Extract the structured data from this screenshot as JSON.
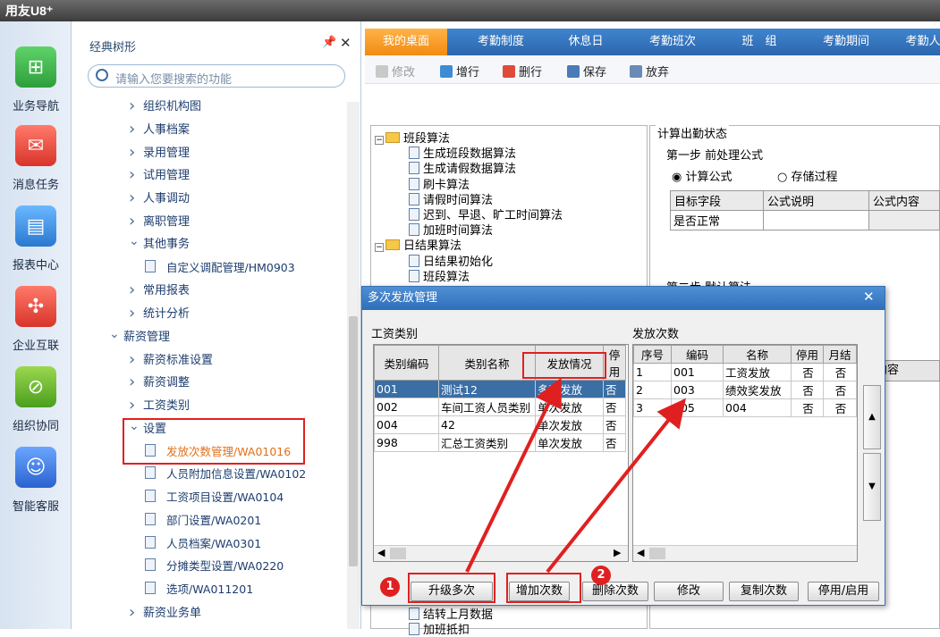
{
  "app": {
    "logo": "用友U8⁺"
  },
  "leftnav": [
    {
      "label": "业务导航",
      "icon": "business-navigation-icon",
      "color": "#3db34a"
    },
    {
      "label": "消息任务",
      "icon": "message-task-icon",
      "color": "#e8504a"
    },
    {
      "label": "报表中心",
      "icon": "report-center-icon",
      "color": "#2f8ee0"
    },
    {
      "label": "企业互联",
      "icon": "enterprise-connect-icon",
      "color": "#e8504a"
    },
    {
      "label": "组织协同",
      "icon": "org-collaboration-icon",
      "color": "#6bb82e"
    },
    {
      "label": "智能客服",
      "icon": "smart-service-icon",
      "color": "#3a7bd8"
    }
  ],
  "treepanel": {
    "title": "经典树形",
    "search_placeholder": "请输入您要搜索的功能",
    "nodes": [
      {
        "label": "组织机构图",
        "kind": "folder"
      },
      {
        "label": "人事档案",
        "kind": "folder"
      },
      {
        "label": "录用管理",
        "kind": "folder"
      },
      {
        "label": "试用管理",
        "kind": "folder"
      },
      {
        "label": "人事调动",
        "kind": "folder"
      },
      {
        "label": "离职管理",
        "kind": "folder"
      },
      {
        "label": "其他事务",
        "kind": "open"
      },
      {
        "label": "自定义调配管理/HM0903",
        "kind": "leaf"
      },
      {
        "label": "常用报表",
        "kind": "folder"
      },
      {
        "label": "统计分析",
        "kind": "folder"
      },
      {
        "label": "薪资管理",
        "kind": "open-root"
      },
      {
        "label": "薪资标准设置",
        "kind": "folder"
      },
      {
        "label": "薪资调整",
        "kind": "folder"
      },
      {
        "label": "工资类别",
        "kind": "folder"
      },
      {
        "label": "设置",
        "kind": "open"
      },
      {
        "label": "发放次数管理/WA01016",
        "kind": "leaf-active"
      },
      {
        "label": "人员附加信息设置/WA0102",
        "kind": "leaf"
      },
      {
        "label": "工资项目设置/WA0104",
        "kind": "leaf"
      },
      {
        "label": "部门设置/WA0201",
        "kind": "leaf"
      },
      {
        "label": "人员档案/WA0301",
        "kind": "leaf"
      },
      {
        "label": "分摊类型设置/WA0220",
        "kind": "leaf"
      },
      {
        "label": "选项/WA011201",
        "kind": "leaf"
      },
      {
        "label": "薪资业务单",
        "kind": "folder"
      }
    ]
  },
  "tabs": [
    "我的桌面",
    "考勤制度",
    "休息日",
    "考勤班次",
    "班　组",
    "考勤期间",
    "考勤人"
  ],
  "toolbar": [
    "修改",
    "增行",
    "删行",
    "保存",
    "放弃"
  ],
  "algtree": [
    {
      "label": "班段算法",
      "level": 0,
      "folder": true
    },
    {
      "label": "生成班段数据算法",
      "level": 1
    },
    {
      "label": "生成请假数据算法",
      "level": 1
    },
    {
      "label": "刷卡算法",
      "level": 1
    },
    {
      "label": "请假时间算法",
      "level": 1
    },
    {
      "label": "迟到、早退、旷工时间算法",
      "level": 1
    },
    {
      "label": "加班时间算法",
      "level": 1
    },
    {
      "label": "日结果算法",
      "level": 0,
      "folder": true
    },
    {
      "label": "日结果初始化",
      "level": 1
    },
    {
      "label": "班段算法",
      "level": 1
    }
  ],
  "algtree_bottom": [
    "结转上月数据",
    "加班抵扣"
  ],
  "calcpanel": {
    "group_title": "计算出勤状态",
    "step1": "第一步  前处理公式",
    "radio_formula": "计算公式",
    "radio_proc": "存储过程",
    "columns": [
      "目标字段",
      "公式说明",
      "公式内容"
    ],
    "rows": [
      [
        "是否正常",
        "",
        ""
      ]
    ],
    "step2": "第二步  默认算法",
    "formula_content": "式内容"
  },
  "dialog": {
    "title": "多次发放管理",
    "left_label": "工资类别",
    "right_label": "发放次数",
    "left_columns": [
      "类别编码",
      "类别名称",
      "发放情况",
      "停用"
    ],
    "left_rows": [
      [
        "001",
        "测试12",
        "多次发放",
        "否"
      ],
      [
        "002",
        "车间工资人员类别",
        "单次发放",
        "否"
      ],
      [
        "004",
        "42",
        "单次发放",
        "否"
      ],
      [
        "998",
        "汇总工资类别",
        "单次发放",
        "否"
      ]
    ],
    "right_columns": [
      "序号",
      "编码",
      "名称",
      "停用",
      "月结"
    ],
    "right_rows": [
      [
        "1",
        "001",
        "工资发放",
        "否",
        "否"
      ],
      [
        "2",
        "003",
        "绩效奖发放",
        "否",
        "否"
      ],
      [
        "3",
        "005",
        "004",
        "否",
        "否"
      ]
    ],
    "buttons": [
      "升级多次",
      "增加次数",
      "删除次数",
      "修改",
      "复制次数",
      "停用/启用"
    ]
  },
  "annotations": {
    "badge1": "1",
    "badge2": "2",
    "highlight_color": "#e02020"
  }
}
